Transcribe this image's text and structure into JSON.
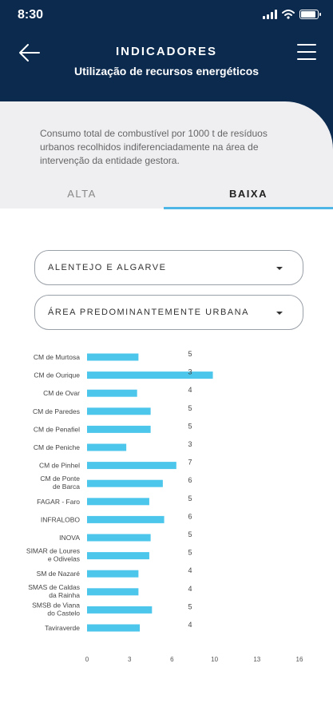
{
  "status_bar": {
    "time": "8:30",
    "battery_level": 0.9
  },
  "header": {
    "title": "INDICADORES",
    "subtitle": "Utilização de recursos energéticos",
    "back_icon": "arrow-left-icon",
    "menu_icon": "hamburger-menu-icon"
  },
  "description": "Consumo total de combustível por 1000 t de resíduos urbanos recolhidos indiferenciadamente na área de intervenção da entidade gestora.",
  "tabs": [
    {
      "label": "ALTA",
      "active": false
    },
    {
      "label": "BAIXA",
      "active": true
    }
  ],
  "filters": {
    "region": "ALENTEJO E ALGARVE",
    "area_type": "ÁREA PREDOMINANTEMENTE URBANA"
  },
  "colors": {
    "header_bg": "#0b2a4e",
    "accent": "#4db6e6",
    "bar": "#4dc6ec",
    "card_bg": "#efeff2"
  },
  "chart_data": {
    "type": "bar",
    "orientation": "horizontal",
    "categories": [
      [
        "CM de Murtosa"
      ],
      [
        "CM de Ourique"
      ],
      [
        "CM de Ovar"
      ],
      [
        "CM de Paredes"
      ],
      [
        "CM de Penafiel"
      ],
      [
        "CM de Peniche"
      ],
      [
        "CM de Pinhel"
      ],
      [
        "CM de Ponte",
        "de Barca"
      ],
      [
        "FAGAR - Faro"
      ],
      [
        "INFRALOBO"
      ],
      [
        "INOVA"
      ],
      [
        "SIMAR de Loures",
        "e Odivelas"
      ],
      [
        "SM de Nazaré"
      ],
      [
        "SMAS de Caldas",
        "da Rainha"
      ],
      [
        "SMSB de Viana",
        "do Castelo"
      ],
      [
        "Taviraverde"
      ]
    ],
    "values": [
      3.8,
      9.3,
      3.7,
      4.7,
      4.7,
      2.9,
      6.6,
      5.6,
      4.6,
      5.7,
      4.7,
      4.6,
      3.8,
      3.8,
      4.8,
      3.9
    ],
    "labels": [
      "5",
      "3",
      "4",
      "5",
      "5",
      "3",
      "7",
      "6",
      "5",
      "6",
      "5",
      "5",
      "4",
      "4",
      "5",
      "4"
    ],
    "xticks": [
      "0",
      "3",
      "6",
      "10",
      "13",
      "16"
    ],
    "xlim": [
      0,
      15.7
    ]
  }
}
